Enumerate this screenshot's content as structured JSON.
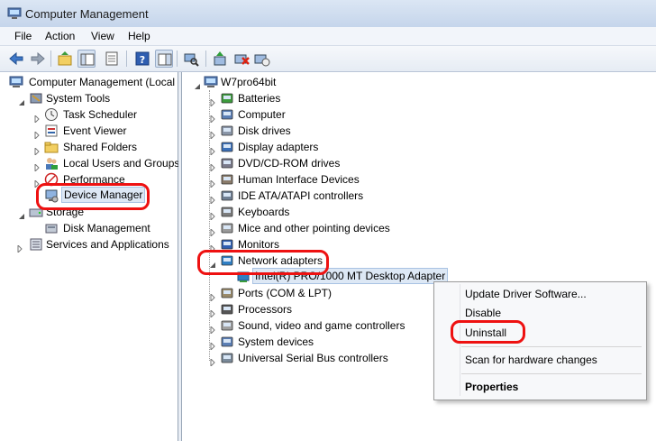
{
  "window": {
    "title": "Computer Management"
  },
  "menu": [
    "File",
    "Action",
    "View",
    "Help"
  ],
  "left_tree": {
    "root": "Computer Management (Local",
    "system_tools": "System Tools",
    "task_scheduler": "Task Scheduler",
    "event_viewer": "Event Viewer",
    "shared_folders": "Shared Folders",
    "local_users": "Local Users and Groups",
    "performance": "Performance",
    "device_manager": "Device Manager",
    "storage": "Storage",
    "disk_management": "Disk Management",
    "services": "Services and Applications"
  },
  "device_tree": {
    "root": "W7pro64bit",
    "categories": [
      "Batteries",
      "Computer",
      "Disk drives",
      "Display adapters",
      "DVD/CD-ROM drives",
      "Human Interface Devices",
      "IDE ATA/ATAPI controllers",
      "Keyboards",
      "Mice and other pointing devices",
      "Monitors",
      "Network adapters",
      "Ports (COM & LPT)",
      "Processors",
      "Sound, video and game controllers",
      "System devices",
      "Universal Serial Bus controllers"
    ],
    "network_device": "Intel(R) PRO/1000 MT Desktop Adapter"
  },
  "context_menu": {
    "update": "Update Driver Software...",
    "disable": "Disable",
    "uninstall": "Uninstall",
    "scan": "Scan for hardware changes",
    "properties": "Properties"
  },
  "colors": {
    "highlight": "#ee1111",
    "selection": "#dde8f5"
  }
}
